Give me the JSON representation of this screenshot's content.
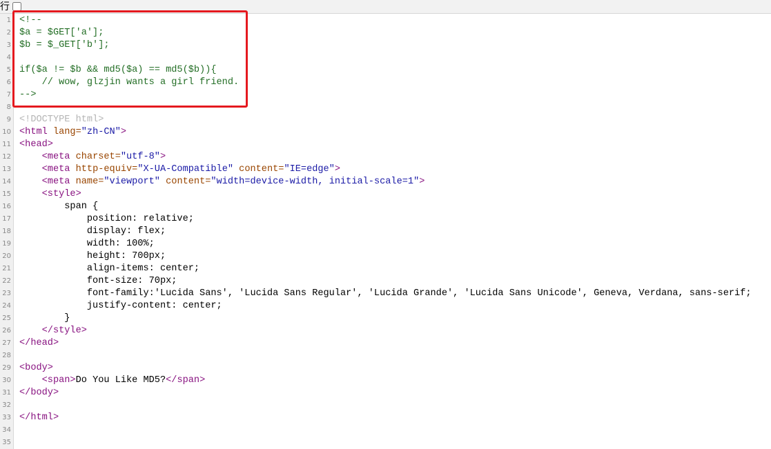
{
  "toolbar": {
    "wrap_label": "行"
  },
  "colors": {
    "comment": "#236e25",
    "tag": "#881280",
    "attr": "#994500",
    "value": "#1a1aa6",
    "doctype": "#b5b5b5",
    "highlight": "#e5191f"
  },
  "lines": [
    {
      "n": "1",
      "parts": [
        {
          "t": "<!--",
          "c": "comment"
        }
      ]
    },
    {
      "n": "2",
      "parts": [
        {
          "t": "$a = $GET['a'];",
          "c": "comment"
        }
      ]
    },
    {
      "n": "3",
      "parts": [
        {
          "t": "$b = $_GET['b'];",
          "c": "comment"
        }
      ]
    },
    {
      "n": "4",
      "parts": []
    },
    {
      "n": "5",
      "parts": [
        {
          "t": "if($a != $b && md5($a) == md5($b)){",
          "c": "comment"
        }
      ]
    },
    {
      "n": "6",
      "parts": [
        {
          "t": "    // wow, glzjin wants a girl friend.",
          "c": "comment"
        }
      ]
    },
    {
      "n": "7",
      "parts": [
        {
          "t": "-->",
          "c": "comment"
        }
      ]
    },
    {
      "n": "8",
      "parts": []
    },
    {
      "n": "9",
      "parts": [
        {
          "t": "<!DOCTYPE html>",
          "c": "doctype"
        }
      ]
    },
    {
      "n": "10",
      "parts": [
        {
          "t": "<html ",
          "c": "tag"
        },
        {
          "t": "lang=",
          "c": "attr"
        },
        {
          "t": "\"zh-CN\"",
          "c": "val"
        },
        {
          "t": ">",
          "c": "tag"
        }
      ]
    },
    {
      "n": "11",
      "parts": [
        {
          "t": "<head>",
          "c": "tag"
        }
      ]
    },
    {
      "n": "12",
      "parts": [
        {
          "t": "    ",
          "c": "text"
        },
        {
          "t": "<meta ",
          "c": "tag"
        },
        {
          "t": "charset=",
          "c": "attr"
        },
        {
          "t": "\"utf-8\"",
          "c": "val"
        },
        {
          "t": ">",
          "c": "tag"
        }
      ]
    },
    {
      "n": "13",
      "parts": [
        {
          "t": "    ",
          "c": "text"
        },
        {
          "t": "<meta ",
          "c": "tag"
        },
        {
          "t": "http-equiv=",
          "c": "attr"
        },
        {
          "t": "\"X-UA-Compatible\" ",
          "c": "val"
        },
        {
          "t": "content=",
          "c": "attr"
        },
        {
          "t": "\"IE=edge\"",
          "c": "val"
        },
        {
          "t": ">",
          "c": "tag"
        }
      ]
    },
    {
      "n": "14",
      "parts": [
        {
          "t": "    ",
          "c": "text"
        },
        {
          "t": "<meta ",
          "c": "tag"
        },
        {
          "t": "name=",
          "c": "attr"
        },
        {
          "t": "\"viewport\" ",
          "c": "val"
        },
        {
          "t": "content=",
          "c": "attr"
        },
        {
          "t": "\"width=device-width, initial-scale=1\"",
          "c": "val"
        },
        {
          "t": ">",
          "c": "tag"
        }
      ]
    },
    {
      "n": "15",
      "parts": [
        {
          "t": "    ",
          "c": "text"
        },
        {
          "t": "<style>",
          "c": "tag"
        }
      ]
    },
    {
      "n": "16",
      "parts": [
        {
          "t": "        span {",
          "c": "text"
        }
      ]
    },
    {
      "n": "17",
      "parts": [
        {
          "t": "            position: relative;",
          "c": "text"
        }
      ]
    },
    {
      "n": "18",
      "parts": [
        {
          "t": "            display: flex;",
          "c": "text"
        }
      ]
    },
    {
      "n": "19",
      "parts": [
        {
          "t": "            width: 100%;",
          "c": "text"
        }
      ]
    },
    {
      "n": "20",
      "parts": [
        {
          "t": "            height: 700px;",
          "c": "text"
        }
      ]
    },
    {
      "n": "21",
      "parts": [
        {
          "t": "            align-items: center;",
          "c": "text"
        }
      ]
    },
    {
      "n": "22",
      "parts": [
        {
          "t": "            font-size: 70px;",
          "c": "text"
        }
      ]
    },
    {
      "n": "23",
      "parts": [
        {
          "t": "            font-family:'Lucida Sans', 'Lucida Sans Regular', 'Lucida Grande', 'Lucida Sans Unicode', Geneva, Verdana, sans-serif;",
          "c": "text"
        }
      ]
    },
    {
      "n": "24",
      "parts": [
        {
          "t": "            justify-content: center;",
          "c": "text"
        }
      ]
    },
    {
      "n": "25",
      "parts": [
        {
          "t": "        }",
          "c": "text"
        }
      ]
    },
    {
      "n": "26",
      "parts": [
        {
          "t": "    ",
          "c": "text"
        },
        {
          "t": "</style>",
          "c": "tag"
        }
      ]
    },
    {
      "n": "27",
      "parts": [
        {
          "t": "</head>",
          "c": "tag"
        }
      ]
    },
    {
      "n": "28",
      "parts": []
    },
    {
      "n": "29",
      "parts": [
        {
          "t": "<body>",
          "c": "tag"
        }
      ]
    },
    {
      "n": "30",
      "parts": [
        {
          "t": "    ",
          "c": "text"
        },
        {
          "t": "<span>",
          "c": "tag"
        },
        {
          "t": "Do You Like MD5?",
          "c": "text"
        },
        {
          "t": "</span>",
          "c": "tag"
        }
      ]
    },
    {
      "n": "31",
      "parts": [
        {
          "t": "</body>",
          "c": "tag"
        }
      ]
    },
    {
      "n": "32",
      "parts": []
    },
    {
      "n": "33",
      "parts": [
        {
          "t": "</html>",
          "c": "tag"
        }
      ]
    },
    {
      "n": "34",
      "parts": []
    },
    {
      "n": "35",
      "parts": []
    }
  ]
}
